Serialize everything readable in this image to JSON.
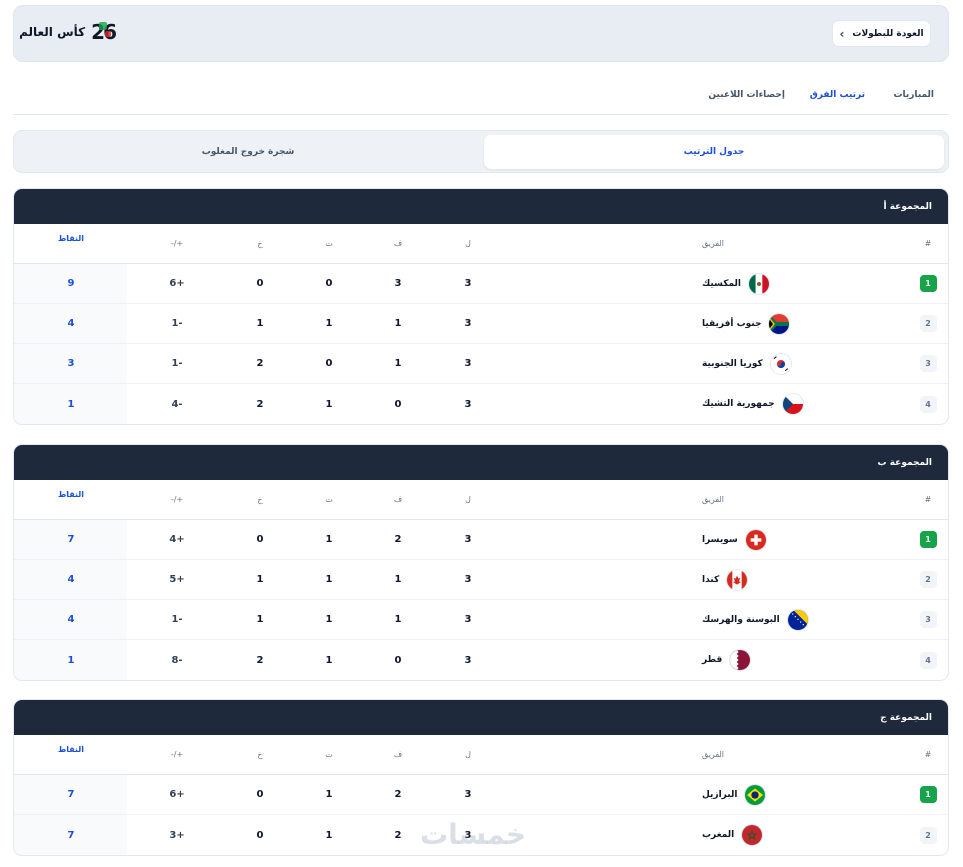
{
  "header": {
    "title": "كأس العالم",
    "logo": "26",
    "back_label": "العودة للبطولات"
  },
  "nav": {
    "tabs": [
      {
        "label": "المباريات",
        "active": false
      },
      {
        "label": "ترتيب الفرق",
        "active": true
      },
      {
        "label": "إحصاءات اللاعبين",
        "active": false
      }
    ]
  },
  "segments": [
    {
      "label": "جدول الترتيب",
      "active": true
    },
    {
      "label": "شجرة خروج المغلوب",
      "active": false
    }
  ],
  "columns": {
    "pos": "#",
    "team": "الفريق",
    "played": "ل",
    "won": "ف",
    "drawn": "ت",
    "lost": "خ",
    "gd": "+/-",
    "points": "النقاط"
  },
  "groups": [
    {
      "title": "المجموعة أ",
      "rows": [
        {
          "pos": "1",
          "qualified": true,
          "team": "المكسيك",
          "flag": "mexico",
          "p": "3",
          "w": "3",
          "d": "0",
          "l": "0",
          "gd": "+6",
          "pts": "9"
        },
        {
          "pos": "2",
          "qualified": false,
          "team": "جنوب أفريقيا",
          "flag": "south-africa",
          "p": "3",
          "w": "1",
          "d": "1",
          "l": "1",
          "gd": "-1",
          "pts": "4"
        },
        {
          "pos": "3",
          "qualified": false,
          "team": "كوريا الجنوبية",
          "flag": "south-korea",
          "p": "3",
          "w": "1",
          "d": "0",
          "l": "2",
          "gd": "-1",
          "pts": "3"
        },
        {
          "pos": "4",
          "qualified": false,
          "team": "جمهورية التشيك",
          "flag": "czech",
          "p": "3",
          "w": "0",
          "d": "1",
          "l": "2",
          "gd": "-4",
          "pts": "1"
        }
      ]
    },
    {
      "title": "المجموعة ب",
      "rows": [
        {
          "pos": "1",
          "qualified": true,
          "team": "سويسرا",
          "flag": "switzerland",
          "p": "3",
          "w": "2",
          "d": "1",
          "l": "0",
          "gd": "+4",
          "pts": "7"
        },
        {
          "pos": "2",
          "qualified": false,
          "team": "كندا",
          "flag": "canada",
          "p": "3",
          "w": "1",
          "d": "1",
          "l": "1",
          "gd": "+5",
          "pts": "4"
        },
        {
          "pos": "3",
          "qualified": false,
          "team": "البوسنة والهرسك",
          "flag": "bosnia",
          "p": "3",
          "w": "1",
          "d": "1",
          "l": "1",
          "gd": "-1",
          "pts": "4"
        },
        {
          "pos": "4",
          "qualified": false,
          "team": "قطر",
          "flag": "qatar",
          "p": "3",
          "w": "0",
          "d": "1",
          "l": "2",
          "gd": "-8",
          "pts": "1"
        }
      ]
    },
    {
      "title": "المجموعة ج",
      "rows": [
        {
          "pos": "1",
          "qualified": true,
          "team": "البرازيل",
          "flag": "brazil",
          "p": "3",
          "w": "2",
          "d": "1",
          "l": "0",
          "gd": "+6",
          "pts": "7"
        },
        {
          "pos": "2",
          "qualified": false,
          "team": "المغرب",
          "flag": "morocco",
          "p": "3",
          "w": "2",
          "d": "1",
          "l": "0",
          "gd": "+3",
          "pts": "7"
        }
      ]
    }
  ],
  "watermark": "خمسات",
  "colors": {
    "header_bg": "#1e293b",
    "accent": "#1d4ed8",
    "qualified": "#16a34a"
  }
}
